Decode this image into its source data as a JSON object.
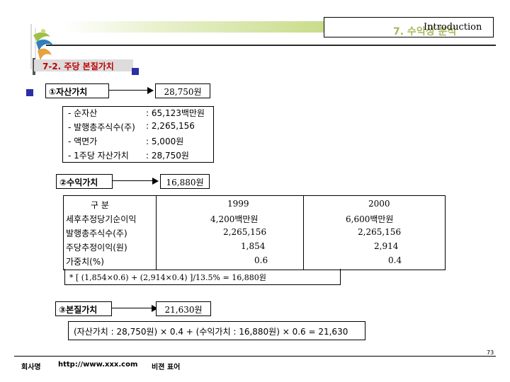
{
  "header": {
    "title_en": "Introduction",
    "title_ko": "7. 수익성 분석"
  },
  "section": {
    "title": "7-2. 주당 본질가치"
  },
  "asset_value": {
    "label": "자산가치",
    "label_number": "①",
    "value": "28,750원",
    "items": [
      {
        "name": "- 순자산",
        "value": ": 65,123백만원"
      },
      {
        "name": "- 발행총주식수(주)",
        "value": ": 2,265,156"
      },
      {
        "name": "- 액면가",
        "value": ": 5,000원"
      },
      {
        "name": "- 1주당 자산가치",
        "value": ": 28,750원"
      }
    ]
  },
  "earnings_value": {
    "label": "수익가치",
    "label_number": "②",
    "value": "16,880원",
    "table": {
      "header": [
        "구 분",
        "1999",
        "2000"
      ],
      "rows": [
        [
          "세후추정당기순이익",
          "4,200백만원",
          "6,600백만원"
        ],
        [
          "발행총주식수(주)",
          "2,265,156",
          "2,265,156"
        ],
        [
          "주당추정이익(원)",
          "1,854",
          "2,914"
        ],
        [
          "가중치(%)",
          "0.6",
          "0.4"
        ]
      ]
    },
    "formula": "* [ (1,854×0.6) + (2,914×0.4) ]/13.5% = 16,880원"
  },
  "intrinsic_value": {
    "label": "본질가치",
    "label_number": "③",
    "value": "21,630원",
    "formula": "(자산가치 : 28,750원) × 0.4 + (수익가치 : 16,880원) × 0.6 = 21,630"
  },
  "footer": {
    "company": "회사명",
    "url": "http://www.xxx.com",
    "slogan": "비젼 표어",
    "page": "73"
  }
}
